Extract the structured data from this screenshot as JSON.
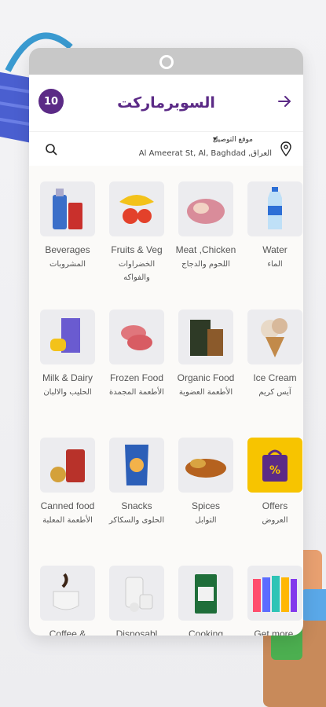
{
  "header": {
    "title": "السوبرماركت",
    "logo_text": "10"
  },
  "location": {
    "label": "موقع التوصيل",
    "address": "Al Ameerat St, Al, Baghdad ,العراق"
  },
  "icons": {
    "back": "arrow-right-icon",
    "search": "search-icon",
    "pin": "location-pin-icon",
    "chevron": "chevron-down-icon"
  },
  "colors": {
    "brand": "#5b2a86",
    "offers_tile": "#f7c400"
  },
  "categories": [
    {
      "en": "Beverages",
      "ar": "المشروبات",
      "icon": "soda-icon"
    },
    {
      "en": "Fruits & Veg",
      "ar": "الخضراوات والفواكه",
      "icon": "fruits-icon"
    },
    {
      "en": "Meat ,Chicken",
      "ar": "اللحوم والدجاج",
      "icon": "meat-icon"
    },
    {
      "en": "Water",
      "ar": "الماء",
      "icon": "water-bottle-icon"
    },
    {
      "en": "Milk & Dairy",
      "ar": "الحليب والالبان",
      "icon": "milk-icon"
    },
    {
      "en": "Frozen Food",
      "ar": "الأطعمة المجمدة",
      "icon": "frozen-food-icon"
    },
    {
      "en": "Organic Food",
      "ar": "الأطعمة العضوية",
      "icon": "organic-food-icon"
    },
    {
      "en": "Ice Cream",
      "ar": "آيس كريم",
      "icon": "ice-cream-icon"
    },
    {
      "en": "Canned food",
      "ar": "الأطعمة المعلبة",
      "icon": "canned-food-icon"
    },
    {
      "en": "Snacks",
      "ar": "الحلوى والسكاكر",
      "icon": "snacks-icon"
    },
    {
      "en": "Spices",
      "ar": "التوابل",
      "icon": "spices-icon"
    },
    {
      "en": "Offers",
      "ar": "العروض",
      "icon": "offers-icon"
    },
    {
      "en": "Coffee &",
      "ar": "",
      "icon": "coffee-icon"
    },
    {
      "en": "Disposabl",
      "ar": "",
      "icon": "disposables-icon"
    },
    {
      "en": "Cooking",
      "ar": "",
      "icon": "cooking-icon"
    },
    {
      "en": "Get more.",
      "ar": "",
      "icon": "get-more-icon"
    }
  ]
}
